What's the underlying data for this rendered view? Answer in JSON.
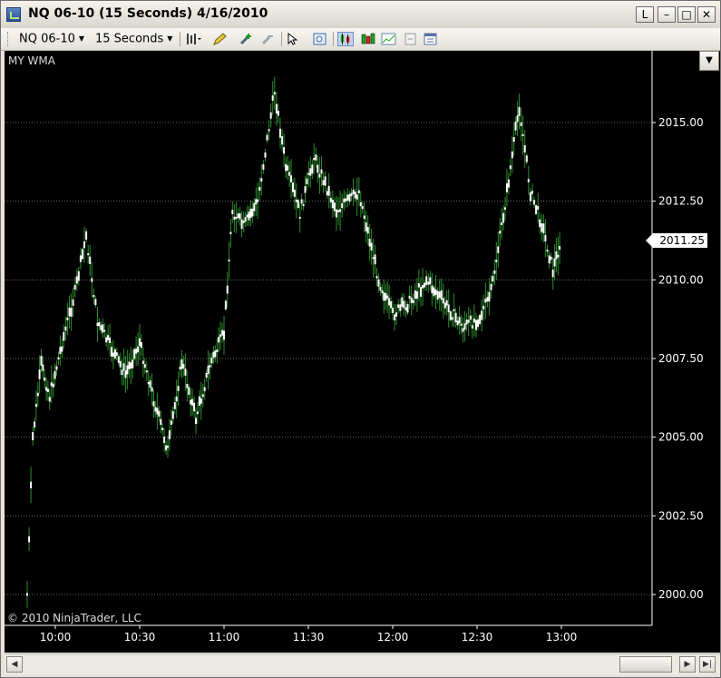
{
  "window": {
    "title": "NQ 06-10 (15 Seconds)  4/16/2010",
    "buttons": {
      "link": "L",
      "minimize": "–",
      "maximize": "□",
      "close": "✕"
    }
  },
  "toolbar": {
    "instrument": "NQ 06-10",
    "interval": "15 Seconds",
    "icons": [
      "bar-type-icon",
      "pencil-draw-icon",
      "zoom-in-icon",
      "zoom-out-icon",
      "cursor-pointer-icon",
      "data-box-icon",
      "candlestick-icon",
      "ohlc-bar-icon",
      "indicator-icon",
      "strategy-icon",
      "properties-icon"
    ]
  },
  "chart": {
    "indicator_label": "MY WMA",
    "copyright": "© 2010 NinjaTrader, LLC",
    "last_price": "2011.25",
    "colors": {
      "background": "#000000",
      "up_bar": "#ffffff",
      "wick": "#2e8b2e",
      "grid": "#6a6a6a",
      "axis_text": "#ffffff"
    }
  },
  "chart_data": {
    "type": "candlestick",
    "instrument": "NQ 06-10",
    "interval": "15 Seconds",
    "date": "4/16/2010",
    "x_ticks": [
      "10:00",
      "10:30",
      "11:00",
      "11:30",
      "12:00",
      "12:30",
      "13:00"
    ],
    "y_ticks": [
      "2000.00",
      "2002.50",
      "2005.00",
      "2007.50",
      "2010.00",
      "2012.50",
      "2015.00"
    ],
    "ylim": [
      1999.75,
      2016.25
    ],
    "last_price": 2011.25,
    "approx_path": [
      {
        "time": "09:50",
        "price": 2000.0
      },
      {
        "time": "09:52",
        "price": 2005.0
      },
      {
        "time": "09:55",
        "price": 2007.3
      },
      {
        "time": "09:58",
        "price": 2006.3
      },
      {
        "time": "10:03",
        "price": 2008.2
      },
      {
        "time": "10:07",
        "price": 2009.6
      },
      {
        "time": "10:11",
        "price": 2011.4
      },
      {
        "time": "10:15",
        "price": 2008.7
      },
      {
        "time": "10:20",
        "price": 2007.8
      },
      {
        "time": "10:25",
        "price": 2007.0
      },
      {
        "time": "10:30",
        "price": 2008.0
      },
      {
        "time": "10:35",
        "price": 2006.2
      },
      {
        "time": "10:40",
        "price": 2004.6
      },
      {
        "time": "10:45",
        "price": 2007.4
      },
      {
        "time": "10:50",
        "price": 2005.6
      },
      {
        "time": "10:55",
        "price": 2007.3
      },
      {
        "time": "11:00",
        "price": 2008.3
      },
      {
        "time": "11:03",
        "price": 2012.2
      },
      {
        "time": "11:07",
        "price": 2011.7
      },
      {
        "time": "11:12",
        "price": 2012.5
      },
      {
        "time": "11:18",
        "price": 2016.0
      },
      {
        "time": "11:22",
        "price": 2013.6
      },
      {
        "time": "11:27",
        "price": 2012.1
      },
      {
        "time": "11:32",
        "price": 2013.9
      },
      {
        "time": "11:40",
        "price": 2012.2
      },
      {
        "time": "11:48",
        "price": 2012.8
      },
      {
        "time": "11:55",
        "price": 2010.0
      },
      {
        "time": "12:00",
        "price": 2008.9
      },
      {
        "time": "12:06",
        "price": 2009.3
      },
      {
        "time": "12:12",
        "price": 2010.0
      },
      {
        "time": "12:18",
        "price": 2009.3
      },
      {
        "time": "12:25",
        "price": 2008.5
      },
      {
        "time": "12:31",
        "price": 2008.8
      },
      {
        "time": "12:35",
        "price": 2009.6
      },
      {
        "time": "12:40",
        "price": 2012.4
      },
      {
        "time": "12:45",
        "price": 2015.5
      },
      {
        "time": "12:49",
        "price": 2012.8
      },
      {
        "time": "12:53",
        "price": 2011.8
      },
      {
        "time": "12:57",
        "price": 2010.3
      },
      {
        "time": "13:00",
        "price": 2011.3
      }
    ]
  }
}
